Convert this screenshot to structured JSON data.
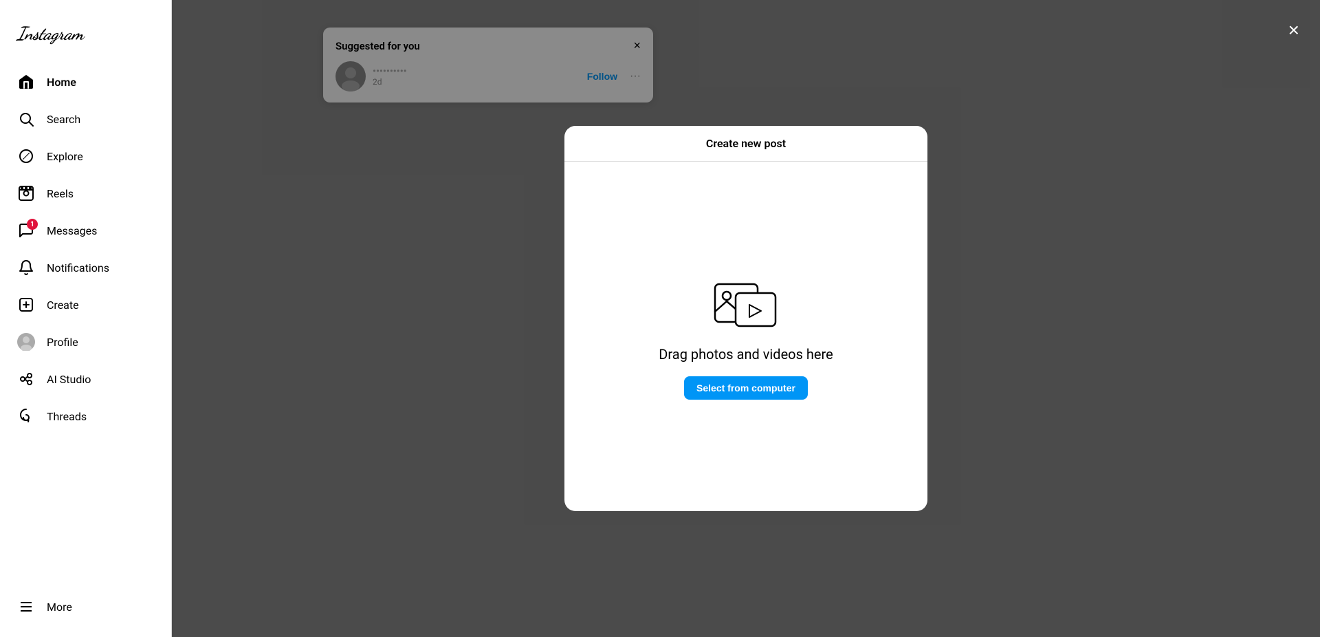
{
  "app": {
    "name": "Instagram"
  },
  "sidebar": {
    "logo": "Instagram",
    "items": [
      {
        "id": "home",
        "label": "Home",
        "icon": "home",
        "active": true,
        "badge": null
      },
      {
        "id": "search",
        "label": "Search",
        "icon": "search",
        "active": false,
        "badge": null
      },
      {
        "id": "explore",
        "label": "Explore",
        "icon": "explore",
        "active": false,
        "badge": null
      },
      {
        "id": "reels",
        "label": "Reels",
        "icon": "reels",
        "active": false,
        "badge": null
      },
      {
        "id": "messages",
        "label": "Messages",
        "icon": "messages",
        "active": false,
        "badge": "1"
      },
      {
        "id": "notifications",
        "label": "Notifications",
        "icon": "notifications",
        "active": false,
        "badge": null
      },
      {
        "id": "create",
        "label": "Create",
        "icon": "create",
        "active": false,
        "badge": null
      },
      {
        "id": "profile",
        "label": "Profile",
        "icon": "profile",
        "active": false,
        "badge": null
      },
      {
        "id": "ai-studio",
        "label": "AI Studio",
        "icon": "ai-studio",
        "active": false,
        "badge": null
      },
      {
        "id": "threads",
        "label": "Threads",
        "icon": "threads",
        "active": false,
        "badge": null
      }
    ],
    "more_label": "More"
  },
  "modal": {
    "title": "Create new post",
    "drag_text": "Drag photos and videos here",
    "select_button_label": "Select from computer"
  },
  "suggestion": {
    "title": "Suggested for you",
    "close_label": "×",
    "follow_label": "Follow",
    "options_label": "···"
  },
  "page_close_label": "×"
}
